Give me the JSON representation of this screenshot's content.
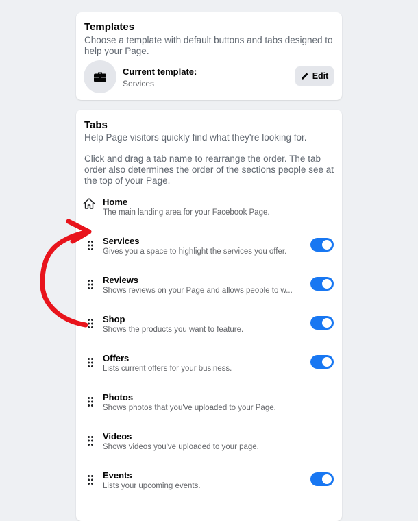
{
  "templates": {
    "title": "Templates",
    "description": "Choose a template with default buttons and tabs designed to help your Page.",
    "current_label": "Current template:",
    "current_value": "Services",
    "edit_label": "Edit"
  },
  "tabs_section": {
    "title": "Tabs",
    "description": "Help Page visitors quickly find what they're looking for.",
    "instructions": "Click and drag a tab name to rearrange the order. The tab order also determines the order of the sections people see at the top of your Page.",
    "items": [
      {
        "name": "Home",
        "description": "The main landing area for your Facebook Page.",
        "icon": "home-icon",
        "toggle": null
      },
      {
        "name": "Services",
        "description": "Gives you a space to highlight the services you offer.",
        "icon": "drag-handle-icon",
        "toggle": true
      },
      {
        "name": "Reviews",
        "description": "Shows reviews on your Page and allows people to w...",
        "icon": "drag-handle-icon",
        "toggle": true
      },
      {
        "name": "Shop",
        "description": "Shows the products you want to feature.",
        "icon": "drag-handle-icon",
        "toggle": true
      },
      {
        "name": "Offers",
        "description": "Lists current offers for your business.",
        "icon": "drag-handle-icon",
        "toggle": true
      },
      {
        "name": "Photos",
        "description": "Shows photos that you've uploaded to your Page.",
        "icon": "drag-handle-icon",
        "toggle": null
      },
      {
        "name": "Videos",
        "description": "Shows videos you've uploaded to your page.",
        "icon": "drag-handle-icon",
        "toggle": null
      },
      {
        "name": "Events",
        "description": "Lists your upcoming events.",
        "icon": "drag-handle-icon",
        "toggle": true
      }
    ]
  },
  "colors": {
    "background": "#eef0f3",
    "toggle_on": "#1877f2",
    "annotation": "#e8141c"
  }
}
